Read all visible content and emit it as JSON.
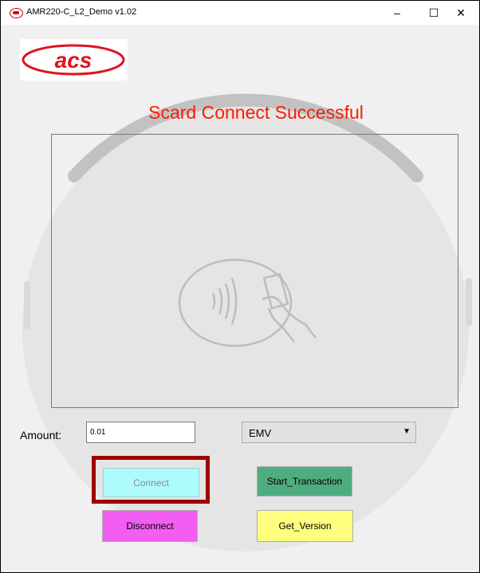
{
  "window": {
    "title": "AMR220-C_L2_Demo v1.02",
    "controls": {
      "minimize": "–",
      "maximize": "☐",
      "close": "✕"
    }
  },
  "logo": {
    "text": "acs",
    "color": "#e0141e"
  },
  "status": {
    "text": "Scard Connect Successful",
    "color": "#ff1a00"
  },
  "form": {
    "amount_label": "Amount:",
    "amount_value": "0.01",
    "mode_selected": "EMV"
  },
  "buttons": {
    "connect": "Connect",
    "start_transaction": "Start_Transaction",
    "disconnect": "Disconnect",
    "get_version": "Get_Version"
  },
  "colors": {
    "connect_bg": "#aefbfb",
    "start_bg": "#4fac7f",
    "disconnect_bg": "#f25df2",
    "version_bg": "#ffff7f",
    "highlight_border": "#a00000"
  },
  "icons": {
    "contactless": "contactless-card-icon",
    "app": "acs-app-icon"
  }
}
